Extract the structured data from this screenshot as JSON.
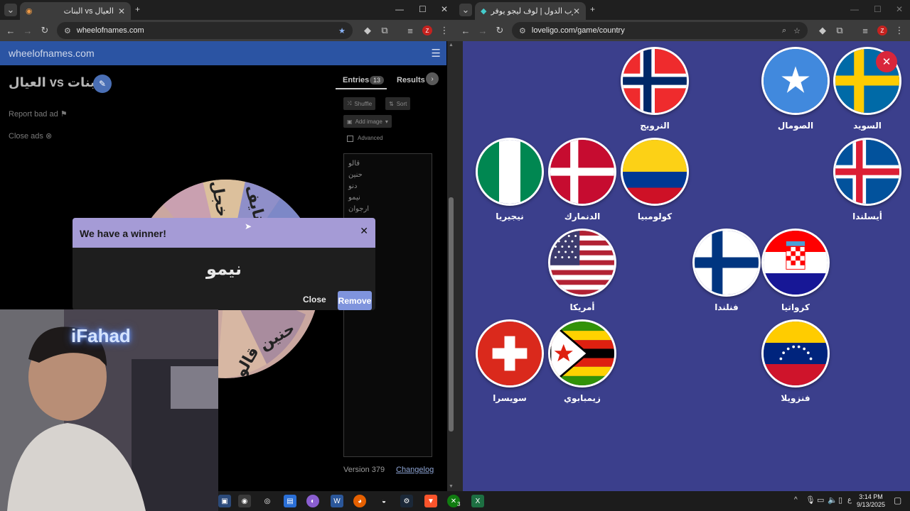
{
  "left_window": {
    "tab_title": "البنات vs العيال",
    "url": "wheelofnames.com"
  },
  "right_window": {
    "tab_title": "لعبة حرب الدول | لوف ليجو يوفر",
    "url": "loveligo.com/game/country"
  },
  "wheel_page": {
    "logo": "wheelofnames.com",
    "title": "البنات vs العيال",
    "report_ad": "Report bad ad",
    "close_ads": "Close ads",
    "wheel_words": [
      "خجل",
      "نايف",
      "حنين",
      "قالو"
    ],
    "tabs": {
      "entries": "Entries",
      "entries_count": "13",
      "results": "Results"
    },
    "buttons": {
      "shuffle": "Shuffle",
      "sort": "Sort",
      "add_image": "Add image",
      "advanced": "Advanced"
    },
    "entries": [
      "قالو",
      "حنين",
      "دنو",
      "نيمو",
      "ارجوان"
    ],
    "version": "Version 379",
    "changelog": "Changelog"
  },
  "modal": {
    "title": "We have a winner!",
    "winner": "نيمو",
    "close": "Close",
    "remove": "Remove"
  },
  "webcam": {
    "neon_text": "iFahad"
  },
  "countries": [
    {
      "name": "النرويج",
      "flag": "norway"
    },
    {
      "name": "الصومال",
      "flag": "somalia"
    },
    {
      "name": "السويد",
      "flag": "sweden"
    },
    {
      "name": "نيجيريا",
      "flag": "nigeria"
    },
    {
      "name": "الدنمارك",
      "flag": "denmark"
    },
    {
      "name": "كولومبيا",
      "flag": "colombia"
    },
    {
      "name": "أيسلندا",
      "flag": "iceland"
    },
    {
      "name": "أمريكا",
      "flag": "usa"
    },
    {
      "name": "فنلندا",
      "flag": "finland"
    },
    {
      "name": "كرواتيا",
      "flag": "croatia"
    },
    {
      "name": "سويسرا",
      "flag": "switzerland"
    },
    {
      "name": "زيمبابوي",
      "flag": "zimbabwe"
    },
    {
      "name": "فنزويلا",
      "flag": "venezuela"
    }
  ],
  "taskbar": {
    "time": "3:14 PM",
    "date": "9/13/2025",
    "lang": "ع",
    "xbox_badge": "3"
  }
}
